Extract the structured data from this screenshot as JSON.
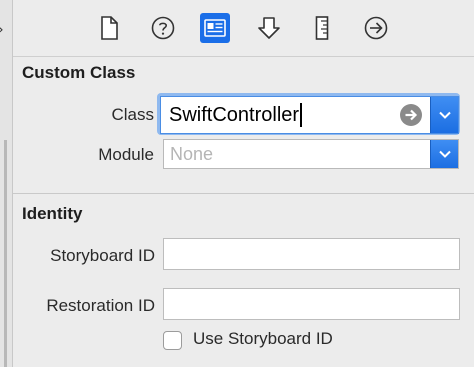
{
  "toolbar": {
    "tabs": [
      {
        "icon": "file-icon"
      },
      {
        "icon": "help-icon"
      },
      {
        "icon": "identity-inspector-icon",
        "selected": true
      },
      {
        "icon": "attributes-inspector-icon"
      },
      {
        "icon": "size-inspector-icon"
      },
      {
        "icon": "connections-inspector-icon"
      }
    ]
  },
  "custom_class": {
    "title": "Custom Class",
    "class_label": "Class",
    "class_value": "SwiftController",
    "module_label": "Module",
    "module_placeholder": "None"
  },
  "identity": {
    "title": "Identity",
    "storyboard_id_label": "Storyboard ID",
    "storyboard_id_value": "",
    "restoration_id_label": "Restoration ID",
    "restoration_id_value": "",
    "use_storyboard_id_label": "Use Storyboard ID",
    "use_storyboard_id_checked": false
  },
  "colors": {
    "accent": "#1a6ee8",
    "focus_ring": "#8fb9ef"
  }
}
